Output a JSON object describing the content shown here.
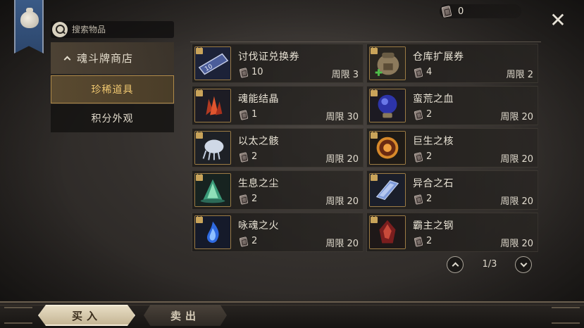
{
  "currency": {
    "amount": "0",
    "icon": "soul-card-icon"
  },
  "search": {
    "placeholder": "搜索物品"
  },
  "sidebar": {
    "shop_title": "魂斗牌商店",
    "items": [
      {
        "label": "珍稀道具",
        "active": true
      },
      {
        "label": "积分外观",
        "active": false
      }
    ]
  },
  "shop": {
    "items": [
      {
        "name": "讨伐证兑换券",
        "price": "10",
        "limit": "周限 3",
        "icon": "ticket-icon"
      },
      {
        "name": "仓库扩展券",
        "price": "4",
        "limit": "周限 2",
        "icon": "backpack-icon"
      },
      {
        "name": "魂能结晶",
        "price": "1",
        "limit": "周限 30",
        "icon": "red-crystal-icon"
      },
      {
        "name": "蛮荒之血",
        "price": "2",
        "limit": "周限 20",
        "icon": "blood-orb-icon"
      },
      {
        "name": "以太之骸",
        "price": "2",
        "limit": "周限 20",
        "icon": "ether-bone-icon"
      },
      {
        "name": "巨生之核",
        "price": "2",
        "limit": "周限 20",
        "icon": "giant-core-icon"
      },
      {
        "name": "生息之尘",
        "price": "2",
        "limit": "周限 20",
        "icon": "green-dust-icon"
      },
      {
        "name": "异合之石",
        "price": "2",
        "limit": "周限 20",
        "icon": "crystal-stone-icon"
      },
      {
        "name": "咏魂之火",
        "price": "2",
        "limit": "周限 20",
        "icon": "blue-flame-icon"
      },
      {
        "name": "霸主之钢",
        "price": "2",
        "limit": "周限 20",
        "icon": "red-steel-icon"
      }
    ]
  },
  "pagination": {
    "label": "1/3"
  },
  "bottom_tabs": {
    "buy": "买入",
    "sell": "卖出"
  }
}
